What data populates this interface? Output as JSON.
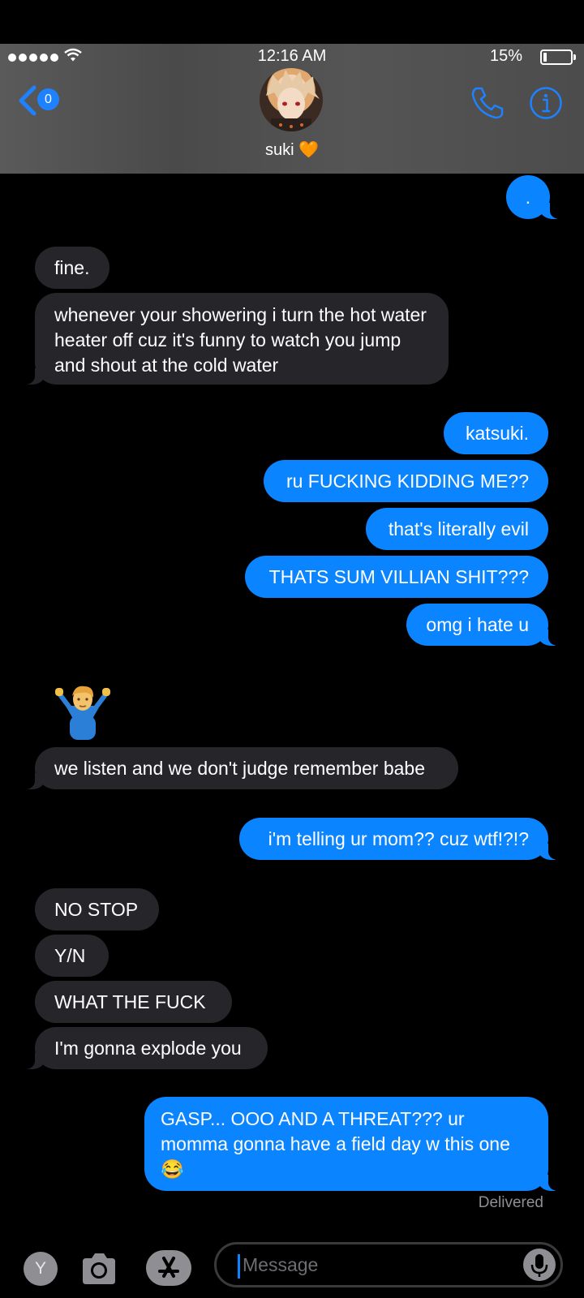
{
  "status_bar": {
    "time": "12:16 AM",
    "battery": "15%"
  },
  "header": {
    "back_count": "0",
    "contact_name": "suki 🧡"
  },
  "messages": {
    "m0": ".",
    "m1": "fine.",
    "m2": "whenever your showering i turn the hot water heater off cuz it's funny to watch you jump and shout at the cold water",
    "m3": "katsuki.",
    "m4": "ru FUCKING KIDDING ME??",
    "m5": "that's literally evil",
    "m6": "THATS SUM VILLIAN SHIT???",
    "m7": "omg i hate u",
    "m8": "🤷‍♂️",
    "m9": "we listen and we don't judge remember babe",
    "m10": "i'm telling ur mom?? cuz wtf!?!?",
    "m11": "NO STOP",
    "m12": "Y/N",
    "m13": "WHAT THE FUCK",
    "m14": "I'm gonna explode you",
    "m15": "GASP... OOO AND A THREAT??? ur momma gonna have a field day w this one 😂"
  },
  "delivered": "Delivered",
  "input": {
    "placeholder": "Message",
    "app_letter": "Y"
  },
  "colors": {
    "outgoing": "#0b84ff",
    "incoming": "#26252a",
    "accent": "#1e82ff"
  }
}
